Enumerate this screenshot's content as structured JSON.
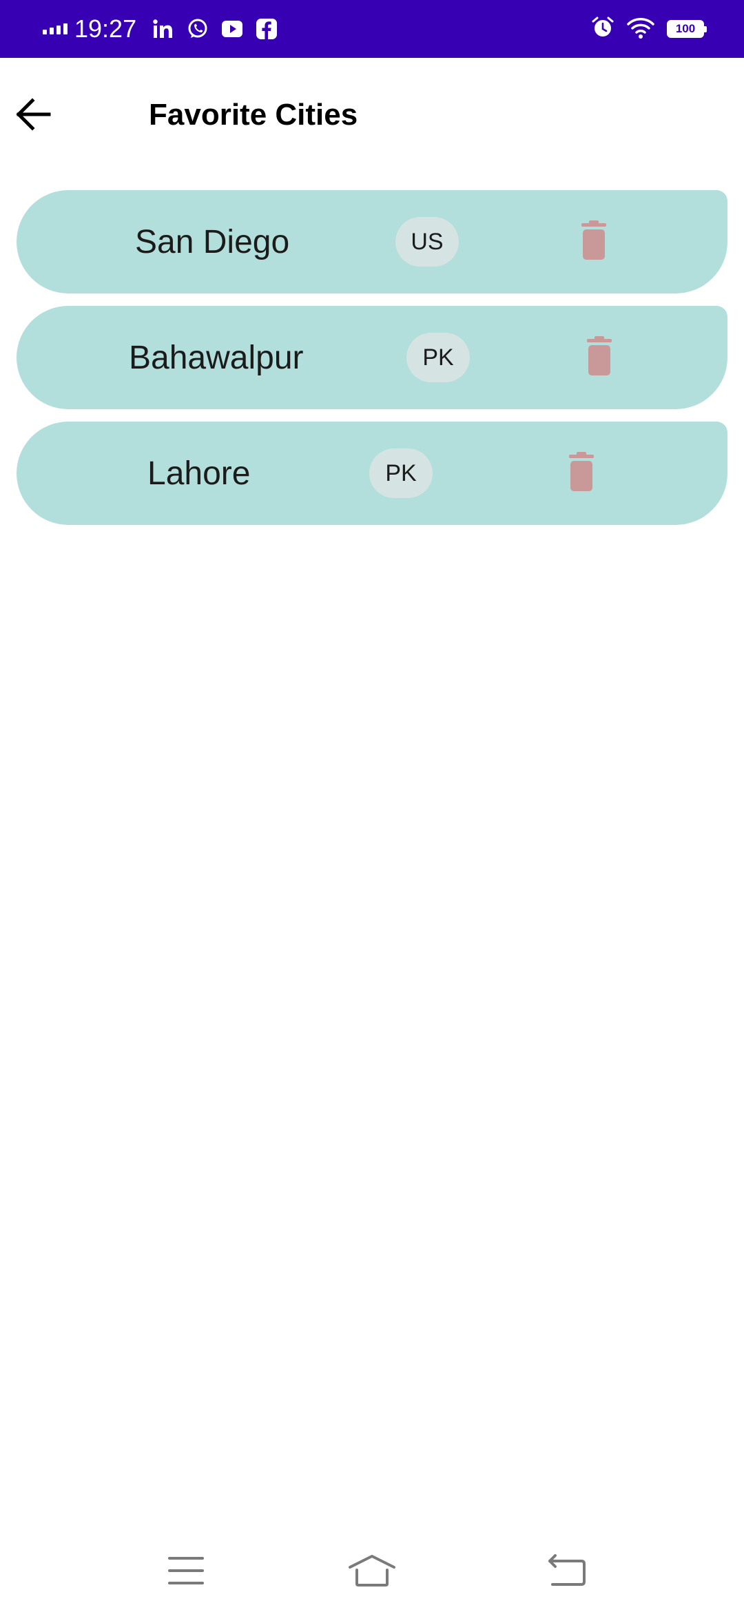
{
  "status_bar": {
    "time": "19:27",
    "battery": "100",
    "app_icons": [
      "linkedin-icon",
      "whatsapp-icon",
      "youtube-icon",
      "facebook-icon"
    ],
    "right_icons": [
      "alarm-icon",
      "wifi-icon",
      "battery-icon"
    ],
    "background_color": "#3700b3"
  },
  "app_bar": {
    "title": "Favorite Cities",
    "back_icon": "arrow-left-icon"
  },
  "cities": [
    {
      "name": "San Diego",
      "country": "US"
    },
    {
      "name": "Bahawalpur",
      "country": "PK"
    },
    {
      "name": "Lahore",
      "country": "PK"
    }
  ],
  "colors": {
    "card_background": "#b2dfdb",
    "chip_background": "#d5e4e3",
    "delete_icon": "#c99898"
  },
  "nav_bar": {
    "items": [
      "menu-icon",
      "home-icon",
      "back-icon"
    ]
  }
}
